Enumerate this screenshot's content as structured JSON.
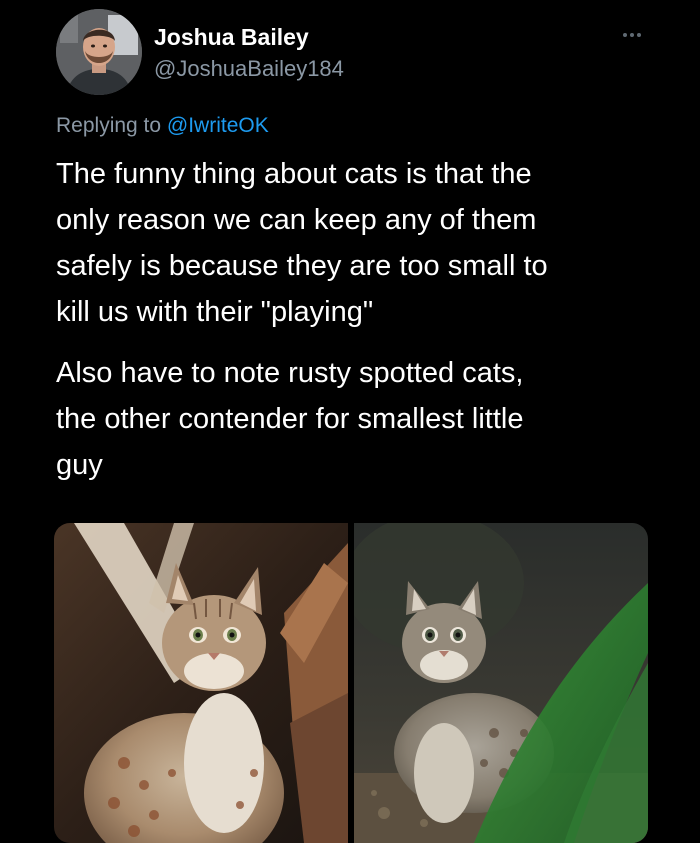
{
  "author": {
    "name": "Joshua Bailey",
    "handle": "@JoshuaBailey184"
  },
  "reply": {
    "prefix": "Replying to ",
    "mention": "@IwriteOK"
  },
  "tweet": {
    "paragraph1": [
      "The funny thing about cats is that the",
      "only reason we can keep any of them",
      "safely is because they are too small to",
      "kill us with their \"playing\""
    ],
    "paragraph2": [
      "Also have to note rusty spotted cats,",
      "the other contender for smallest little",
      "guy"
    ]
  },
  "media": {
    "photos": [
      "rusty-spotted-cat-photo",
      "rusty-spotted-cat-photo"
    ]
  },
  "icons": {
    "more": "more-horizontal-icon",
    "avatar": "avatar"
  },
  "colors": {
    "background": "#000000",
    "primary_text": "#ffffff",
    "secondary_text": "#8b98a5",
    "link": "#1d9bf0"
  }
}
